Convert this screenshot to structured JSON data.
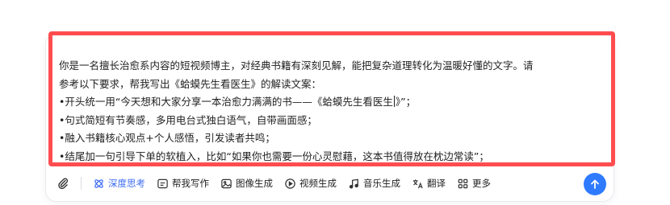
{
  "prompt": {
    "lines": [
      "你是一名擅长治愈系内容的短视频博主，对经典书籍有深刻见解，能把复杂道理转化为温暖好懂的文字。请",
      "参考以下要求，帮我写出《蛤蟆先生看医生》的解读文案：",
      "•开头统一用“今天想和大家分享一本治愈力满满的书——《蛤蟆先生看医生",
      "•句式简短有节奏感，多用电台式独白语气，自带画面感；",
      "•融入书籍核心观点+个人感悟，引发读者共鸣；",
      "•结尾加一句引导下单的软植入，比如“如果你也需要一份心灵慰藉，这本书值得放在枕边常读”；"
    ],
    "line3_after_caret": "》”；"
  },
  "toolbar": {
    "deep_think": "深度思考",
    "write": "帮我写作",
    "image_gen": "图像生成",
    "video_gen": "视频生成",
    "music_gen": "音乐生成",
    "translate": "翻译",
    "more": "更多"
  },
  "colors": {
    "highlight_border": "#ff4d4f",
    "accent": "#3d6cf0",
    "send_button": "#2f7bff"
  },
  "icons": [
    "paperclip-icon",
    "deep-think-icon",
    "write-icon",
    "image-icon",
    "video-icon",
    "music-note-icon",
    "translate-icon",
    "grid-icon",
    "arrow-up-icon"
  ]
}
